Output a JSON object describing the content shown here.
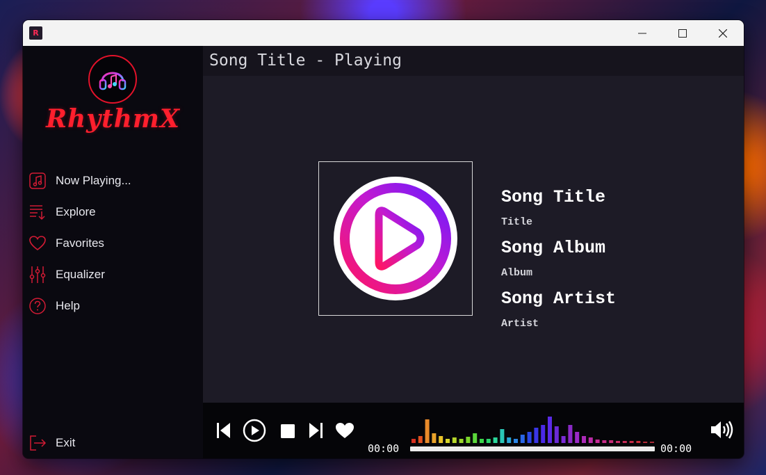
{
  "window": {
    "app_icon_letter": "R",
    "controls": [
      "minimize-icon",
      "maximize-icon",
      "close-icon"
    ]
  },
  "sidebar": {
    "logo_text": "RhythmX",
    "items": [
      {
        "label": "Now Playing...",
        "icon": "music-note-icon"
      },
      {
        "label": "Explore",
        "icon": "playlist-icon"
      },
      {
        "label": "Favorites",
        "icon": "heart-icon"
      },
      {
        "label": "Equalizer",
        "icon": "equalizer-icon"
      },
      {
        "label": "Help",
        "icon": "help-icon"
      }
    ],
    "exit_label": "Exit"
  },
  "main": {
    "header_title": "Song Title - Playing",
    "song": {
      "title_heading": "Song Title",
      "title_value": "Title",
      "album_heading": "Song Album",
      "album_value": "Album",
      "artist_heading": "Song Artist",
      "artist_value": "Artist"
    }
  },
  "player": {
    "elapsed": "00:00",
    "total": "00:00",
    "progress": 0,
    "controls": [
      "previous-icon",
      "play-icon",
      "stop-icon",
      "next-icon",
      "favorite-heart-icon",
      "volume-icon"
    ]
  },
  "colors": {
    "accent": "#e3122a",
    "sidebar_bg": "#0a0910",
    "main_bg": "#1d1b26",
    "player_bg": "#050508"
  }
}
